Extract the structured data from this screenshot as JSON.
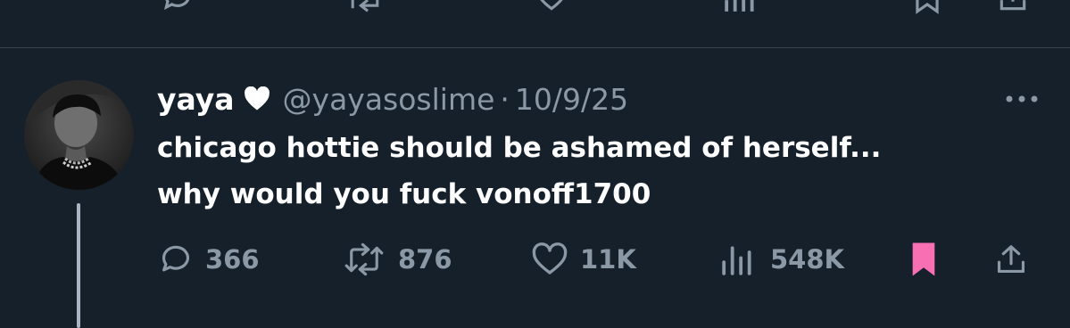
{
  "tweet": {
    "display_name": "yaya",
    "handle": "@yayasoslime",
    "separator": "·",
    "date": "10/9/25",
    "text_lines": [
      "chicago hottie should be ashamed of herself...",
      "why would you fuck vonoff1700"
    ]
  },
  "actions": {
    "replies": "366",
    "retweets": "876",
    "likes": "11K",
    "views": "548K"
  },
  "colors": {
    "background": "#15202b",
    "text_primary": "#ffffff",
    "text_secondary": "#8b98a5",
    "divider": "#38444d",
    "bookmark_active": "#f96fb4",
    "thread_line": "#a9b5c4"
  },
  "icons": {
    "heart_badge": "heart-icon",
    "more": "more-options-icon",
    "reply": "reply-icon",
    "retweet": "retweet-icon",
    "like": "like-icon",
    "views": "views-icon",
    "bookmark": "bookmark-icon",
    "share": "share-icon"
  }
}
